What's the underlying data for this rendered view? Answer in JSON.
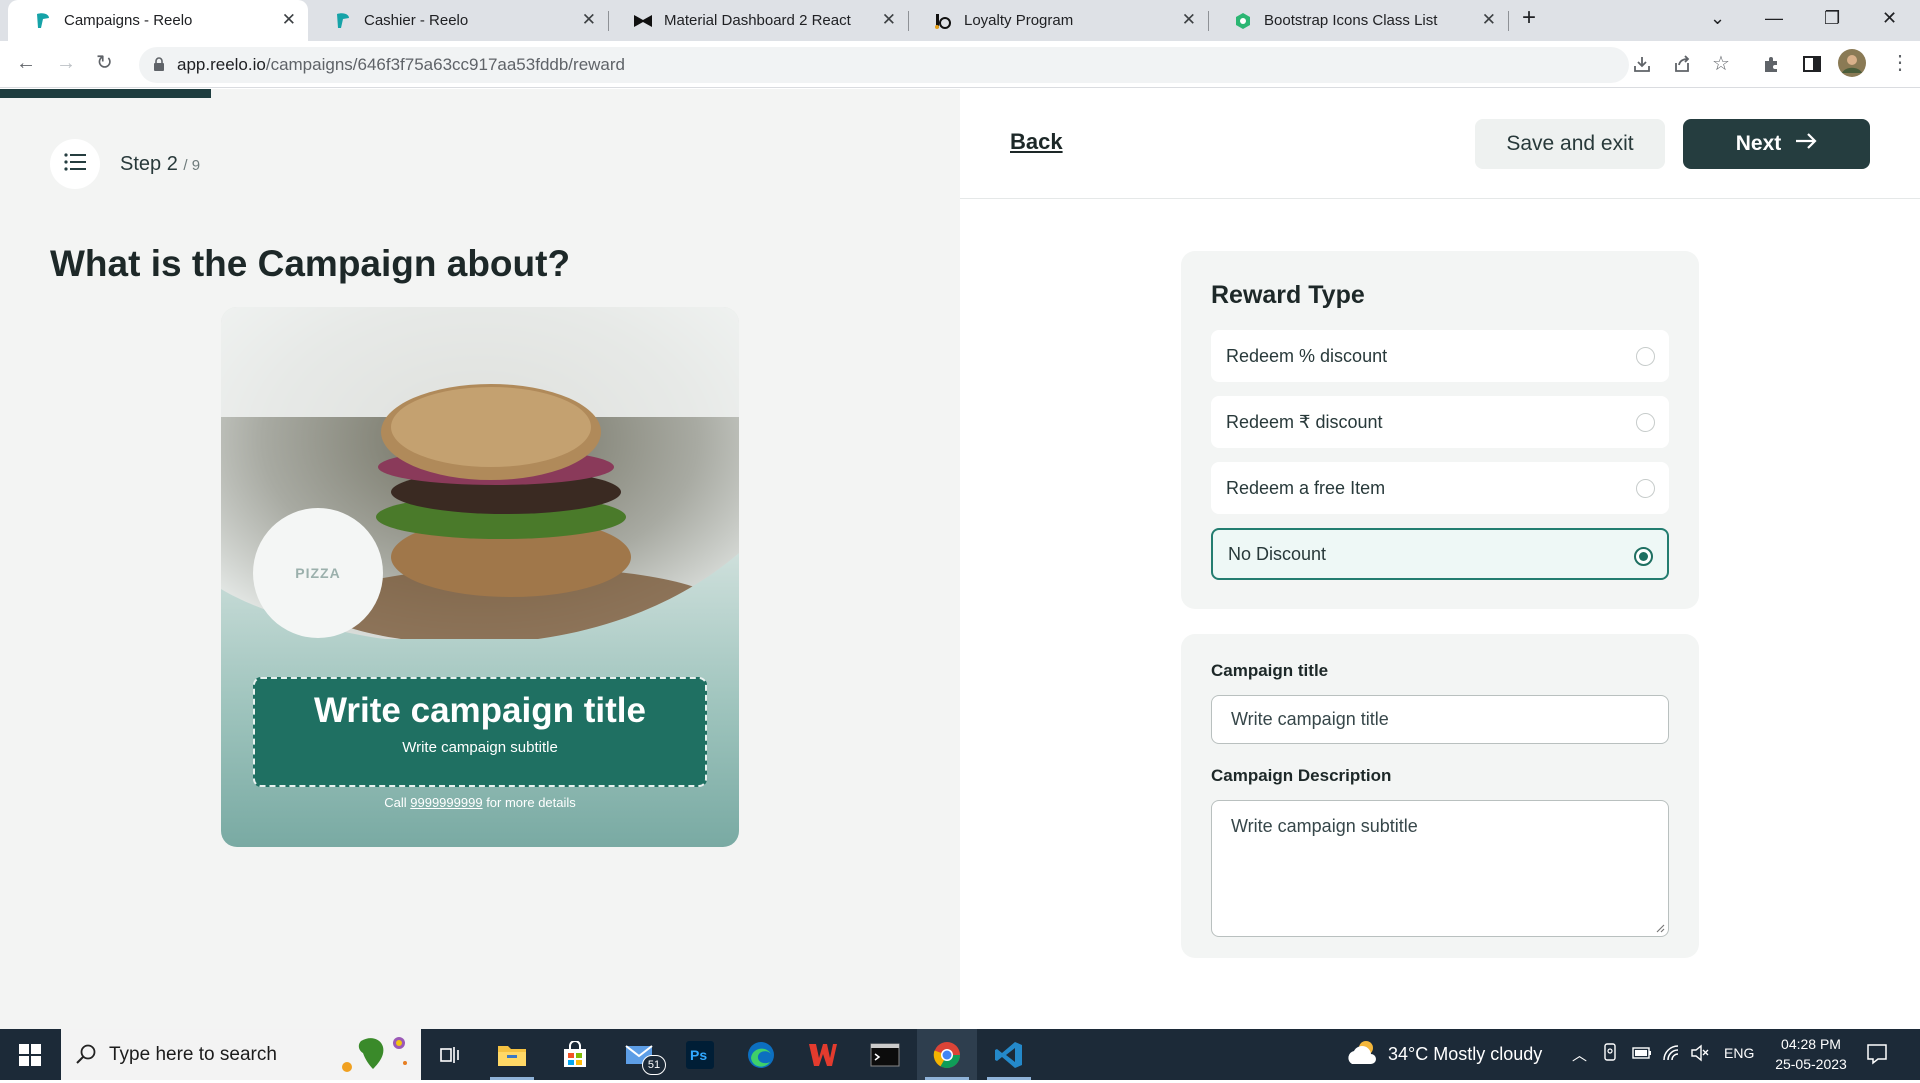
{
  "browser": {
    "tabs": [
      {
        "title": "Campaigns - Reelo",
        "active": true
      },
      {
        "title": "Cashier - Reelo",
        "active": false
      },
      {
        "title": "Material Dashboard 2 React",
        "active": false
      },
      {
        "title": "Loyalty Program",
        "active": false
      },
      {
        "title": "Bootstrap Icons Class List",
        "active": false
      }
    ],
    "url_host": "app.reelo.io",
    "url_path": "/campaigns/646f3f75a63cc917aa53fddb/reward"
  },
  "left": {
    "step_label": "Step 2",
    "step_total": "/ 9",
    "progress_fraction": 0.22,
    "page_title": "What is the Campaign about?",
    "preview": {
      "logo_text": "PIZZA",
      "title": "Write campaign title",
      "subtitle": "Write campaign subtitle",
      "call_prefix": "Call",
      "phone": "9999999999",
      "call_suffix": "for more details"
    }
  },
  "right": {
    "back_label": "Back",
    "save_label": "Save and exit",
    "next_label": "Next",
    "reward_heading": "Reward Type",
    "reward_options": [
      {
        "label": "Redeem % discount",
        "selected": false
      },
      {
        "label": "Redeem ₹ discount",
        "selected": false
      },
      {
        "label": "Redeem a free Item",
        "selected": false
      },
      {
        "label": "No Discount",
        "selected": true
      }
    ],
    "title_label": "Campaign title",
    "title_placeholder": "Write campaign title",
    "desc_label": "Campaign Description",
    "desc_placeholder": "Write campaign subtitle"
  },
  "taskbar": {
    "search_placeholder": "Type here to search",
    "mail_badge": "51",
    "weather": "34°C  Mostly cloudy",
    "lang": "ENG",
    "time": "04:28 PM",
    "date": "25-05-2023"
  },
  "colors": {
    "brand_dark": "#253d3f",
    "brand_green": "#1f7062",
    "selected_bg": "#eef8f6"
  }
}
